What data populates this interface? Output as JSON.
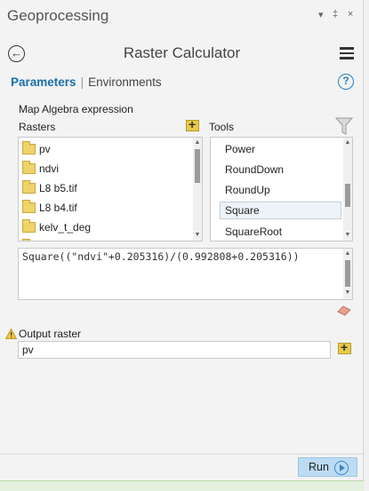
{
  "pane": {
    "title": "Geoprocessing",
    "controls": [
      "▾",
      "‡",
      "×"
    ]
  },
  "header": {
    "title": "Raster Calculator"
  },
  "tabs": {
    "parameters": "Parameters",
    "environments": "Environments",
    "help": "?"
  },
  "map_algebra": {
    "label": "Map Algebra expression",
    "rasters_label": "Rasters",
    "tools_label": "Tools",
    "rasters": [
      "pv",
      "ndvi",
      "L8 b5.tif",
      "L8 b4.tif",
      "kelv_t_deg"
    ],
    "tools": [
      "Power",
      "RoundDown",
      "RoundUp",
      "Square",
      "SquareRoot"
    ],
    "selected_tool": "Square",
    "expression": "Square((\"ndvi\"+0.205316)/(0.992808+0.205316))"
  },
  "output": {
    "label": "Output raster",
    "value": "pv"
  },
  "footer": {
    "run_label": "Run"
  },
  "colors": {
    "accent": "#1a6fa8",
    "run_button": "#bcdcf4",
    "folder": "#efd36b"
  }
}
